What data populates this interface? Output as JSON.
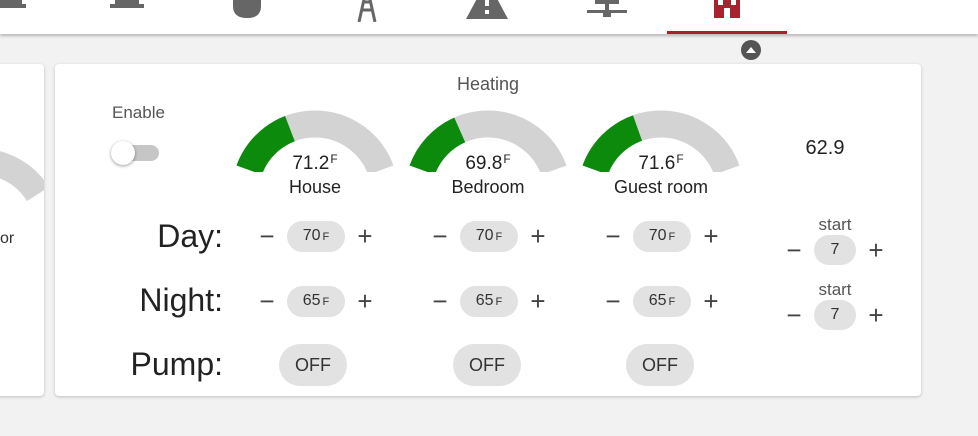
{
  "tabs": [
    {
      "icon": "monitor-icon"
    },
    {
      "icon": "cooking-pot-icon"
    },
    {
      "icon": "stove-icon"
    },
    {
      "icon": "power-tower-icon"
    },
    {
      "icon": "warning-icon"
    },
    {
      "icon": "network-icon"
    },
    {
      "icon": "building-icon",
      "active": true
    }
  ],
  "colors": {
    "accent": "#a8222d",
    "gauge_fill": "#0b8a0b",
    "gauge_track": "#d3d3d3"
  },
  "left_card": {
    "partial_text": "or"
  },
  "heating": {
    "title": "Heating",
    "enable_label": "Enable",
    "enabled": false,
    "outside_temp": "62.9",
    "zones": [
      {
        "name": "House",
        "temp": "71.2",
        "unit": "F",
        "fill_fraction": 0.35,
        "day": {
          "value": "70",
          "unit": "F"
        },
        "night": {
          "value": "65",
          "unit": "F"
        },
        "pump": "OFF"
      },
      {
        "name": "Bedroom",
        "temp": "69.8",
        "unit": "F",
        "fill_fraction": 0.33,
        "day": {
          "value": "70",
          "unit": "F"
        },
        "night": {
          "value": "65",
          "unit": "F"
        },
        "pump": "OFF"
      },
      {
        "name": "Guest room",
        "temp": "71.6",
        "unit": "F",
        "fill_fraction": 0.36,
        "day": {
          "value": "70",
          "unit": "F"
        },
        "night": {
          "value": "65",
          "unit": "F"
        },
        "pump": "OFF"
      }
    ],
    "rows": {
      "day": "Day:",
      "night": "Night:",
      "pump": "Pump:"
    },
    "day_start": {
      "label": "start",
      "value": "7"
    },
    "night_start": {
      "label": "start",
      "value": "7"
    },
    "minus_symbol": "−",
    "plus_symbol": "+"
  }
}
